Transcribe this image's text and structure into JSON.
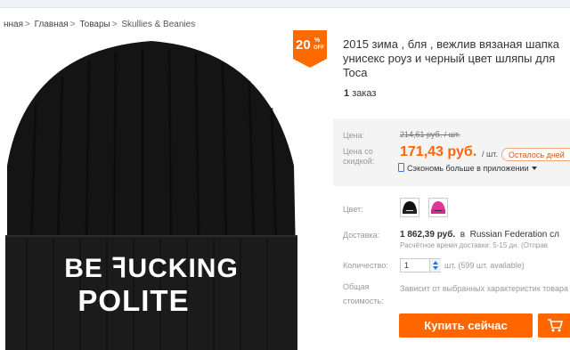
{
  "breadcrumb": {
    "items": [
      "нная",
      "Главная",
      "Товары",
      "Skullies & Beanies"
    ],
    "separator": ">"
  },
  "image": {
    "hat_text_top": "BE ꟻUCKING",
    "hat_text_bottom": "POLITE",
    "badge_percent": "20",
    "badge_sup": "%",
    "badge_off": "OFF"
  },
  "product": {
    "title_lines": [
      "2015 зима , бля , вежлив вязаная шапка",
      "унисекс роуз и черный цвет шляпы для",
      "Toca"
    ],
    "orders_count": "1",
    "orders_label": "заказ"
  },
  "pricing": {
    "price_label": "Цена:",
    "old_price": "214,61 руб. / шт.",
    "discount_label_line1": "Цена со",
    "discount_label_line2": "скидкой:",
    "new_price": "171,43 руб.",
    "unit": "/ шт.",
    "remaining_label": "Осталось дней",
    "app_promo": "Сэкономь больше в приложении"
  },
  "color": {
    "label": "Цвет:",
    "options": [
      "black",
      "pink"
    ]
  },
  "shipping": {
    "label": "Доставка:",
    "price": "1 862,39 руб.",
    "preposition": "в",
    "destination": "Russian Federation сл",
    "estimate": "Расчётное время доставки: 5-15 дн. (Отправ"
  },
  "quantity": {
    "label": "Количество:",
    "value": "1",
    "unit_text": "шт. (599 шт. available)"
  },
  "total": {
    "label_line1": "Общая",
    "label_line2": "стоимость:",
    "text": "Зависит от выбранных характеристик товара"
  },
  "actions": {
    "buy_label": "Купить сейчас"
  },
  "colors": {
    "accent": "#ff6600",
    "price": "#ff6600"
  }
}
